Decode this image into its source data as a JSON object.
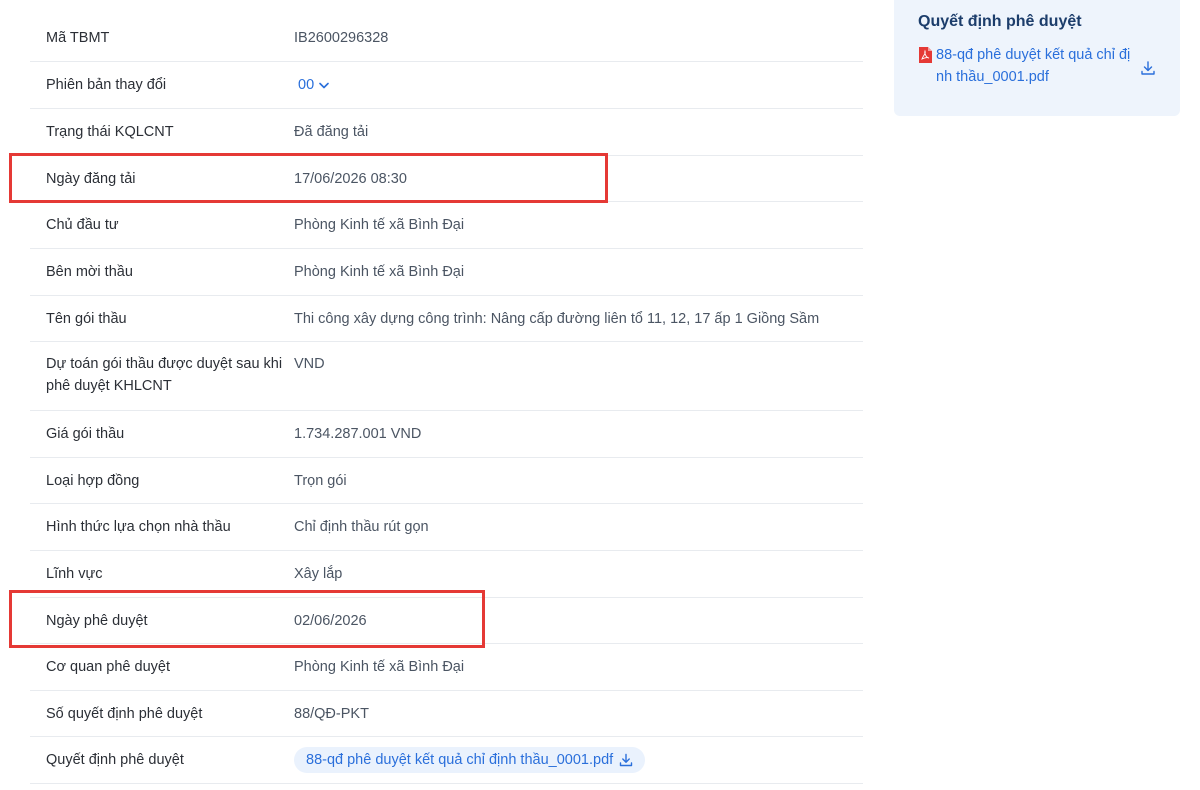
{
  "details": {
    "rows": [
      {
        "label": "Mã TBMT",
        "value": "IB2600296328"
      },
      {
        "label": "Phiên bản thay đổi",
        "value": "00"
      },
      {
        "label": "Trạng thái KQLCNT",
        "value": "Đã đăng tải"
      },
      {
        "label": "Ngày đăng tải",
        "value": "17/06/2026 08:30"
      },
      {
        "label": "Chủ đầu tư",
        "value": "Phòng Kinh tế xã Bình Đại"
      },
      {
        "label": "Bên mời thầu",
        "value": "Phòng Kinh tế xã Bình Đại"
      },
      {
        "label": "Tên gói thầu",
        "value": "Thi công xây dựng công trình: Nâng cấp đường liên tổ 11, 12, 17 ấp 1 Giồng Sầm"
      },
      {
        "label": "Dự toán gói thầu được duyệt sau khi phê duyệt KHLCNT",
        "value": "VND"
      },
      {
        "label": "Giá gói thầu",
        "value": "1.734.287.001 VND"
      },
      {
        "label": "Loại hợp đồng",
        "value": "Trọn gói"
      },
      {
        "label": "Hình thức lựa chọn nhà thầu",
        "value": "Chỉ định thầu rút gọn"
      },
      {
        "label": "Lĩnh vực",
        "value": "Xây lắp"
      },
      {
        "label": "Ngày phê duyệt",
        "value": "02/06/2026"
      },
      {
        "label": "Cơ quan phê duyệt",
        "value": "Phòng Kinh tế xã Bình Đại"
      },
      {
        "label": "Số quyết định phê duyệt",
        "value": "88/QĐ-PKT"
      },
      {
        "label": "Quyết định phê duyệt",
        "value": "88-qđ phê duyệt kết quả chỉ định thầu_0001.pdf"
      }
    ]
  },
  "side_panel": {
    "title": "Quyết định phê duyệt",
    "file_name": "88-qđ phê duyệt kết quả chỉ định thầu_0001.pdf"
  },
  "icons": {
    "version_dropdown": "chevron-down-icon",
    "file_download": "download-icon",
    "file_type": "pdf-icon"
  },
  "colors": {
    "link": "#2a6fdb",
    "highlight_border": "#e53935",
    "side_panel_bg": "#eef4fc",
    "pill_bg": "#eaf2fd",
    "pdf_red": "#e53935"
  }
}
